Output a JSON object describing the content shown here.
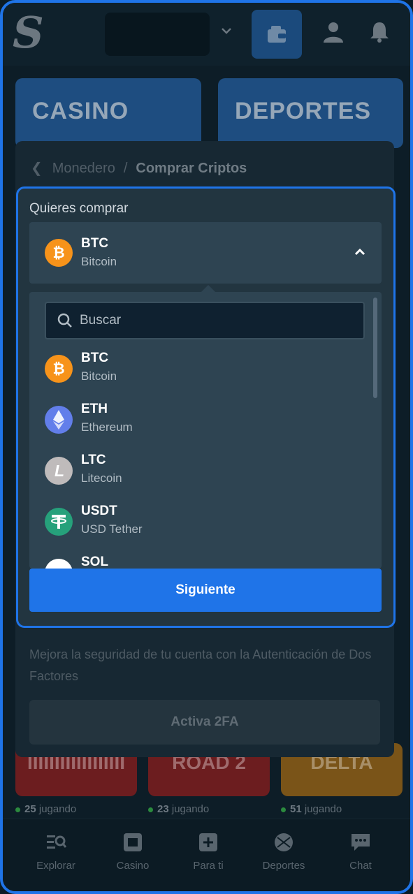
{
  "app": {
    "logo_letter": "S",
    "banners": {
      "casino": "CASINO",
      "sports": "DEPORTES"
    },
    "games": [
      {
        "title": "IIIIIIIIIIIIIIIIII",
        "players": "25",
        "playing_label": "jugando"
      },
      {
        "title": "ROAD 2",
        "players": "23",
        "playing_label": "jugando"
      },
      {
        "title": "DELTA",
        "players": "51",
        "playing_label": "jugando"
      }
    ],
    "bottom_nav": [
      {
        "label": "Explorar",
        "icon": "browse-icon"
      },
      {
        "label": "Casino",
        "icon": "casino-icon"
      },
      {
        "label": "Para ti",
        "icon": "for-you-icon"
      },
      {
        "label": "Deportes",
        "icon": "sports-ball-icon"
      },
      {
        "label": "Chat",
        "icon": "chat-icon"
      }
    ]
  },
  "modal": {
    "breadcrumb": {
      "parent": "Monedero",
      "separator": "/",
      "current": "Comprar Criptos"
    },
    "want_label": "Quieres comprar",
    "selected": {
      "symbol": "BTC",
      "name": "Bitcoin"
    },
    "search": {
      "placeholder": "Buscar",
      "value": ""
    },
    "options": [
      {
        "symbol": "BTC",
        "name": "Bitcoin",
        "color": "#f7931a"
      },
      {
        "symbol": "ETH",
        "name": "Ethereum",
        "color": "#627eea"
      },
      {
        "symbol": "LTC",
        "name": "Litecoin",
        "color": "#bfbbbb"
      },
      {
        "symbol": "USDT",
        "name": "USD Tether",
        "color": "#26a17b"
      },
      {
        "symbol": "SOL",
        "name": "",
        "color": "#ffffff"
      }
    ],
    "next_label": "Siguiente",
    "tfa": {
      "text": "Mejora la seguridad de tu cuenta con la Autenticación de Dos Factores",
      "button": "Activa 2FA"
    }
  },
  "colors": {
    "accent": "#1f74e8",
    "panel": "#223540",
    "field": "#2e4452"
  }
}
